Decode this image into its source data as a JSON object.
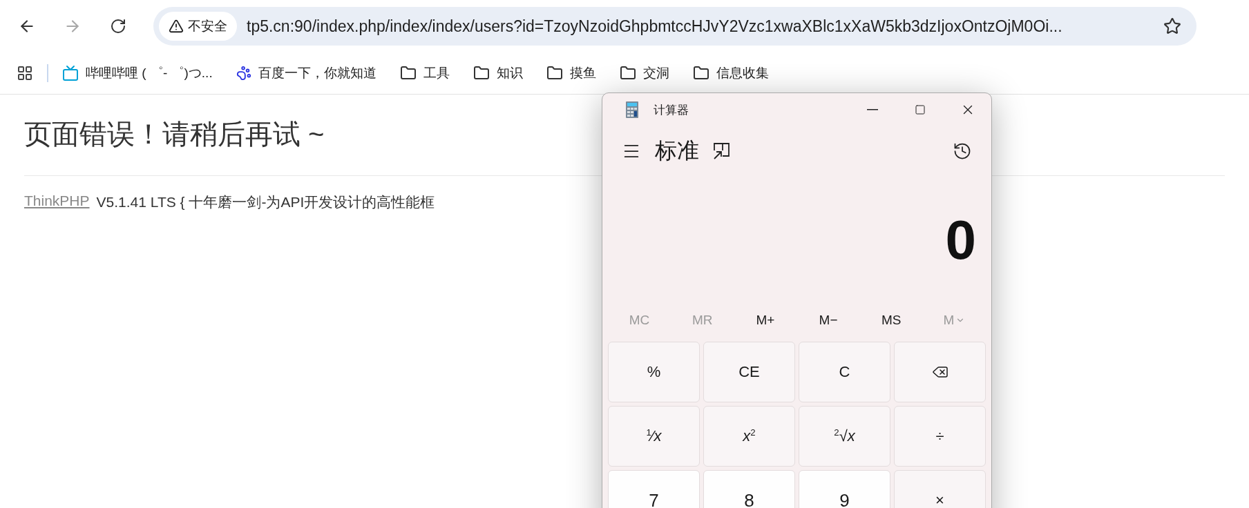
{
  "browser": {
    "nav_buttons": [
      {
        "kind": "back",
        "disabled": false
      },
      {
        "kind": "forward",
        "disabled": true
      },
      {
        "kind": "reload",
        "disabled": false
      }
    ],
    "address_bar": {
      "security_label": "不安全",
      "url": "tp5.cn:90/index.php/index/index/users?id=TzoyNzoidGhpbmtccHJvY2Vzc1xwaXBlc1xXaW5kb3dzIjoxOntzOjM0Oi..."
    },
    "bookmarks": [
      {
        "kind": "tv",
        "label": "哔哩哔哩 ( ゜- ゜)つ..."
      },
      {
        "kind": "paw",
        "label": "百度一下，你就知道"
      },
      {
        "kind": "folder",
        "label": "工具"
      },
      {
        "kind": "folder",
        "label": "知识"
      },
      {
        "kind": "folder",
        "label": "摸鱼"
      },
      {
        "kind": "folder",
        "label": "交洞"
      },
      {
        "kind": "folder",
        "label": "信息收集"
      }
    ]
  },
  "page": {
    "heading": "页面错误！请稍后再试 ~",
    "link": "ThinkPHP",
    "version_text": "V5.1.41 LTS { 十年磨一剑-为API开发设计的高性能框"
  },
  "calculator": {
    "title": "计算器",
    "mode": "标准",
    "display": "0",
    "memory": [
      {
        "label": "MC",
        "disabled": true
      },
      {
        "label": "MR",
        "disabled": true
      },
      {
        "label": "M+",
        "disabled": false
      },
      {
        "label": "M−",
        "disabled": false
      },
      {
        "label": "MS",
        "disabled": false
      },
      {
        "label": "M",
        "disabled": true,
        "kind": "dropdown"
      }
    ],
    "keys": [
      {
        "kind": "function",
        "label": "%"
      },
      {
        "kind": "function",
        "label": "CE"
      },
      {
        "kind": "function",
        "label": "C"
      },
      {
        "kind": "backspace"
      },
      {
        "kind": "function",
        "label": "$^{1}$⁄*x*"
      },
      {
        "kind": "function",
        "label": "*x*$^{2}$"
      },
      {
        "kind": "function",
        "label": "$^{2}$√*x*"
      },
      {
        "kind": "function",
        "label": "÷"
      },
      {
        "kind": "digit",
        "label": "7"
      },
      {
        "kind": "digit",
        "label": "8"
      },
      {
        "kind": "digit",
        "label": "9"
      },
      {
        "kind": "function",
        "label": "×"
      }
    ]
  }
}
